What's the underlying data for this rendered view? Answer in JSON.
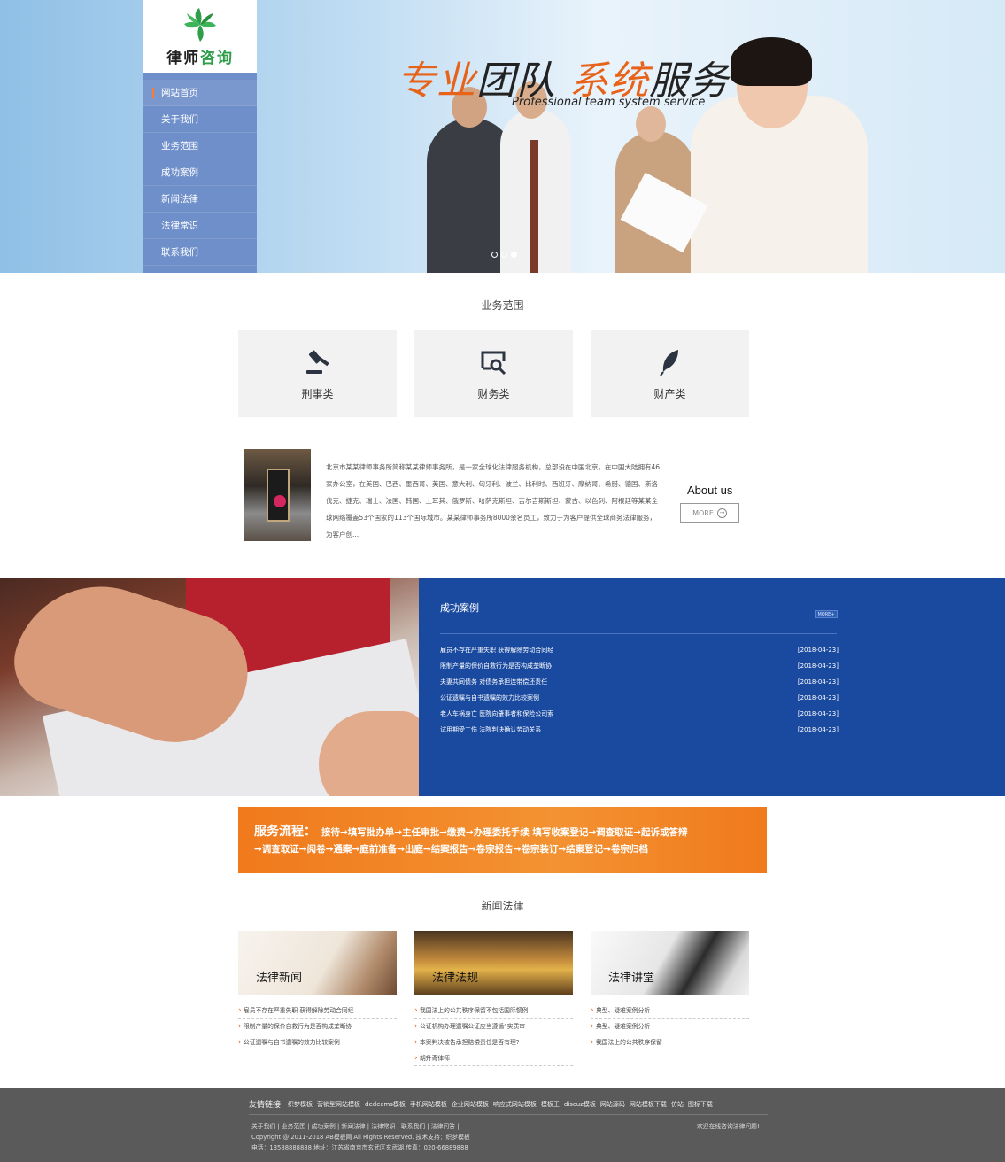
{
  "logo": {
    "text_dark": "律师",
    "text_green": "咨询"
  },
  "nav": {
    "items": [
      {
        "label": "网站首页"
      },
      {
        "label": "关于我们"
      },
      {
        "label": "业务范围"
      },
      {
        "label": "成功案例"
      },
      {
        "label": "新闻法律"
      },
      {
        "label": "法律常识"
      },
      {
        "label": "联系我们"
      }
    ]
  },
  "banner": {
    "slogan_1": "专业",
    "slogan_2": "团队 ",
    "slogan_3": "系统",
    "slogan_4": "服务",
    "slogan_en": "Professional team system service",
    "slides": 3,
    "active_slide": 3
  },
  "business": {
    "title": "业务范围",
    "cards": [
      {
        "label": "刑事类",
        "icon": "gavel-icon"
      },
      {
        "label": "财务类",
        "icon": "search-screen-icon"
      },
      {
        "label": "财产类",
        "icon": "feather-icon"
      }
    ]
  },
  "about": {
    "text": "北京市某某律师事务所简称某某律师事务所，是一家全球化法律服务机构，总部设在中国北京，在中国大陆拥有46家办公室，在美国、巴西、墨西哥、英国、意大利、匈牙利、波兰、比利时、西班牙、摩纳哥、希腊、德国、斯洛伐克、捷克、瑞士、法国、韩国、土耳其、俄罗斯、哈萨克斯坦、吉尔吉斯斯坦、蒙古、以色列、阿根廷等某某全球网络覆盖53个国家的113个国际城市。某某律师事务所8000余名员工，致力于为客户提供全球商务法律服务，为客户创...",
    "title": "About us",
    "more": "MORE"
  },
  "cases": {
    "title": "成功案例",
    "more": "MORE+",
    "items": [
      {
        "title": "雇员不存在严重失职 获得解除劳动合同经",
        "date": "[2018-04-23]"
      },
      {
        "title": "限制产量的保价自救行为是否构成垄断协",
        "date": "[2018-04-23]"
      },
      {
        "title": "夫妻共同债务 对债务承担连带偿还责任",
        "date": "[2018-04-23]"
      },
      {
        "title": "公证遗嘱与自书遗嘱的效力比较案例",
        "date": "[2018-04-23]"
      },
      {
        "title": "老人车祸身亡 医院向肇事者和保险公司索",
        "date": "[2018-04-23]"
      },
      {
        "title": "试用期受工伤 法院判决确认劳动关系",
        "date": "[2018-04-23]"
      }
    ]
  },
  "process": {
    "label": "服务流程：",
    "line_1": "接待→填写批办单→主任审批→缴费→办理委托手续 填写收案登记→调查取证→起诉或答辩",
    "line_2": "→调查取证→阅卷→通案→庭前准备→出庭→结案报告→卷宗报告→卷宗装订→结案登记→卷宗归档"
  },
  "news": {
    "title": "新闻法律",
    "columns": [
      {
        "caption": "法律新闻",
        "items": [
          "雇员不存在严重失职 获得解除劳动合同经",
          "限制产量的保价自救行为是否构成垄断协",
          "公证遗嘱与自书遗嘱的效力比较案例"
        ]
      },
      {
        "caption": "法律法规",
        "items": [
          "我国法上的公共秩序保留不包括国际惯例",
          "公证机构办理遗嘱公证应当遵循“实质审",
          "本案判决被告承担赔偿责任是否有理?",
          "胡升奇律师"
        ]
      },
      {
        "caption": "法律讲堂",
        "items": [
          "典型、疑难案例分析",
          "典型、疑难案例分析",
          "我国法上的公共秩序保留"
        ]
      }
    ]
  },
  "footer": {
    "links_label": "友情链接:",
    "links": [
      "织梦模板",
      "营销型网站模板",
      "dedecms模板",
      "手机网站模板",
      "企业网站模板",
      "响应式网站模板",
      "模板王",
      "discuz模板",
      "网站源码",
      "网站模板下载",
      "仿站",
      "图标下载"
    ],
    "nav_line": "关于我们 | 业务范围 | 成功案例 | 新闻法律 | 法律常识 | 联系我们 | 法律问答 |",
    "copyright": "Copyright @ 2011-2018 AB模板网 All Rights Reserved. 技术支持：织梦模板",
    "contact": "电话：13588888888 地址：江苏省南京市玄武区玄武湖 传真：020-66889888",
    "welcome": "欢迎在线咨询法律问题!"
  },
  "colors": {
    "accent_orange": "#e8631a",
    "nav_blue": "#6f8fca",
    "cases_blue": "#1a4aa0",
    "logo_green": "#2e9e4a"
  }
}
